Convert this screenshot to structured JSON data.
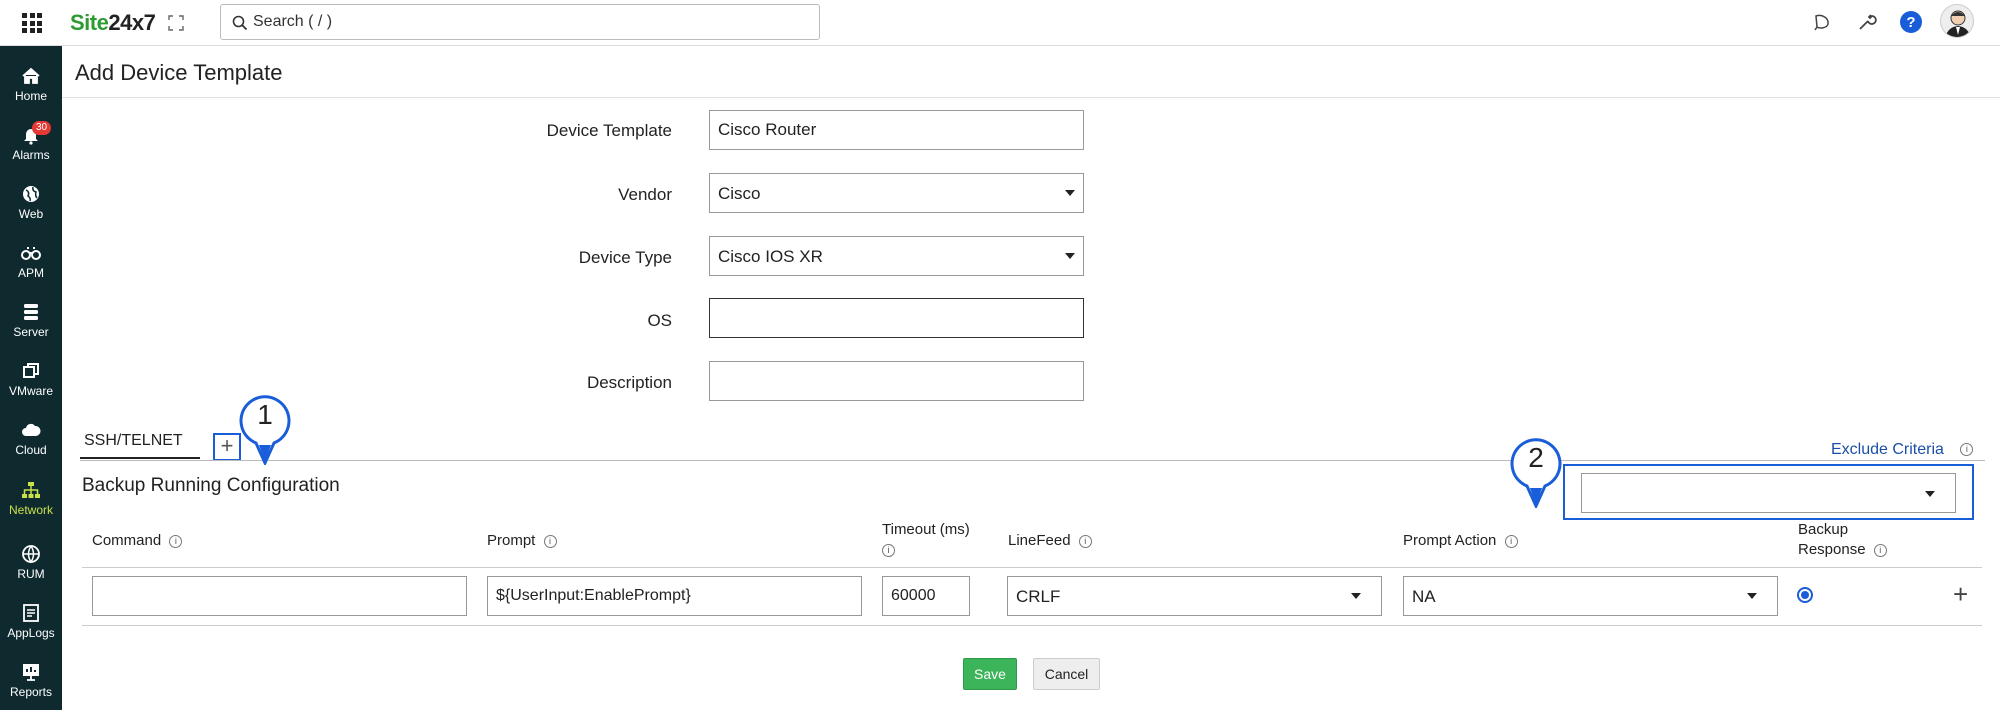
{
  "app": {
    "logo_prefix": "Site",
    "logo_suffix": "24x7",
    "search_placeholder": "Search ( / )"
  },
  "sidebar": {
    "items": [
      {
        "label": "Home",
        "icon": "home-icon"
      },
      {
        "label": "Alarms",
        "icon": "bell-icon",
        "badge": "30"
      },
      {
        "label": "Web",
        "icon": "globe-icon"
      },
      {
        "label": "APM",
        "icon": "binoculars-icon"
      },
      {
        "label": "Server",
        "icon": "server-icon"
      },
      {
        "label": "VMware",
        "icon": "vmware-icon"
      },
      {
        "label": "Cloud",
        "icon": "cloud-icon"
      },
      {
        "label": "Network",
        "icon": "network-icon",
        "active": true
      },
      {
        "label": "RUM",
        "icon": "rum-icon"
      },
      {
        "label": "AppLogs",
        "icon": "applogs-icon"
      },
      {
        "label": "Reports",
        "icon": "reports-icon"
      }
    ]
  },
  "page": {
    "title": "Add Device Template"
  },
  "form": {
    "device_template_label": "Device Template",
    "device_template_value": "Cisco Router",
    "vendor_label": "Vendor",
    "vendor_value": "Cisco",
    "device_type_label": "Device Type",
    "device_type_value": "Cisco IOS XR",
    "os_label": "OS",
    "os_value": "",
    "description_label": "Description",
    "description_value": ""
  },
  "tabs": {
    "active_label": "SSH/TELNET",
    "add_label": "+"
  },
  "callouts": {
    "one": "1",
    "two": "2"
  },
  "section": {
    "title": "Backup Running Configuration",
    "exclude_link": "Exclude Criteria",
    "criteria_value": ""
  },
  "grid": {
    "headers": {
      "command": "Command",
      "prompt": "Prompt",
      "timeout_line1": "Timeout (ms)",
      "linefeed": "LineFeed",
      "prompt_action": "Prompt Action",
      "backup_line1": "Backup",
      "backup_line2": "Response"
    },
    "row": {
      "command": "",
      "prompt": "${UserInput:EnablePrompt}",
      "timeout": "60000",
      "linefeed": "CRLF",
      "prompt_action": "NA",
      "add_label": "+"
    }
  },
  "buttons": {
    "save": "Save",
    "cancel": "Cancel"
  },
  "colors": {
    "sidebar_bg": "#0e2a2f",
    "accent_blue": "#1a5dd8",
    "active_nav": "#c8e04a",
    "save_green": "#3cb45a",
    "link_blue": "#1b4fa8"
  }
}
